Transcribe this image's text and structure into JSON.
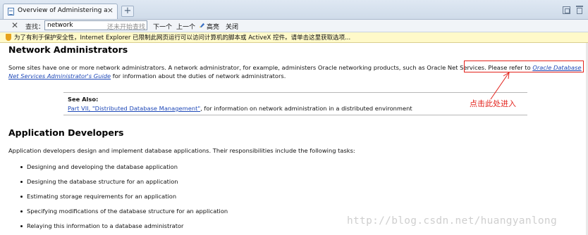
{
  "browser": {
    "tab": {
      "title": "Overview of Administering an Ora...",
      "close": "×"
    },
    "new_tab": "+",
    "find": {
      "close": "✕",
      "label": "查找：",
      "value": "network",
      "status": "还未开始查找",
      "next": "下一个",
      "prev": "上一个",
      "highlight": "高亮",
      "close_find": "关闭"
    },
    "infobar": {
      "text": "为了有利于保护安全性，Internet Explorer 已限制此网页运行可以访问计算机的脚本或 ActiveX 控件。请单击这里获取选项..."
    }
  },
  "page": {
    "network": {
      "heading": "Network Administrators",
      "para_before": "Some sites have one or more network administrators. A network administrator, for example, administers Oracle networking products, such as Oracle Net Services. Please refer to ",
      "link": "Oracle Database Net Services Administrator's Guide",
      "para_after": " for information about the duties of network administrators."
    },
    "see_also": {
      "title": "See Also:",
      "link": "Part VII, \"Distributed Database Management\"",
      "text": ", for information on network administration in a distributed environment"
    },
    "annotation": "点击此处进入",
    "app": {
      "heading": "Application Developers",
      "intro": "Application developers design and implement database applications. Their responsibilities include the following tasks:",
      "tasks": [
        "Designing and developing the database application",
        "Designing the database structure for an application",
        "Estimating storage requirements for an application",
        "Specifying modifications of the database structure for an application",
        "Relaying this information to a database administrator"
      ]
    },
    "watermark": "http://blog.csdn.net/huangyanlong"
  },
  "colors": {
    "link": "#1f49b8",
    "annotation": "#e3221b",
    "infobar_bg": "#fff9c9"
  }
}
